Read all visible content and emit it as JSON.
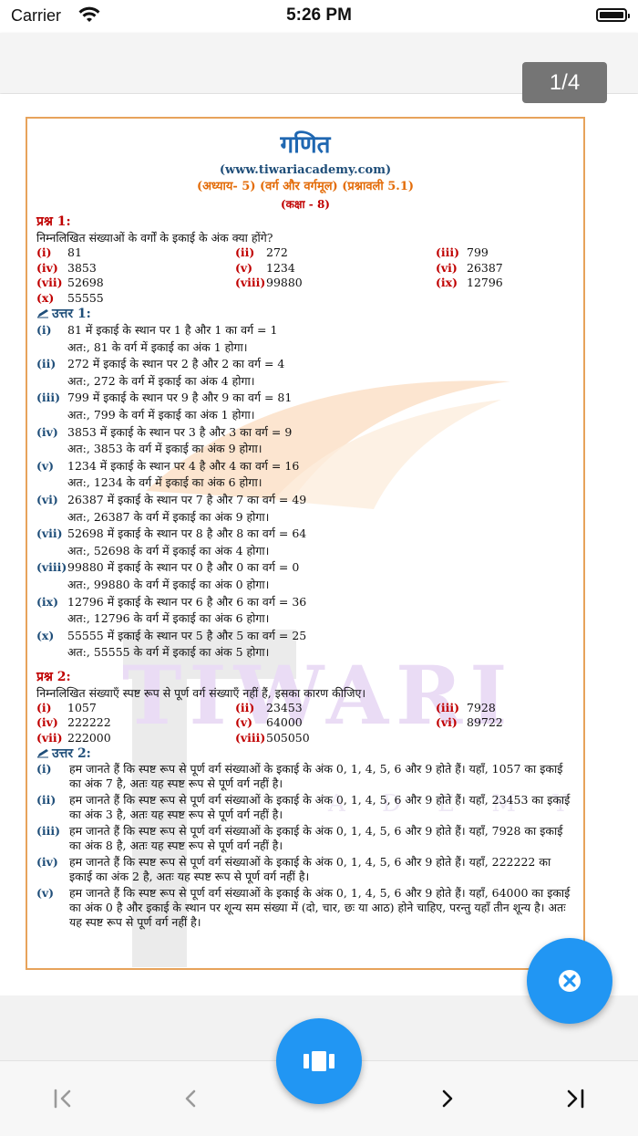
{
  "status_bar": {
    "carrier": "Carrier",
    "time": "5:26 PM"
  },
  "viewer": {
    "page_counter": "1/4"
  },
  "document": {
    "title": "गणित",
    "website": "(www.tiwariacademy.com)",
    "chapter": "(अध्याय- 5) (वर्ग और वर्गमूल) (प्रश्नावली 5.1)",
    "class_label": "(कक्षा - 8)",
    "watermark": {
      "brand": "TIWARI",
      "sub": "A D E M Y"
    },
    "q1": {
      "heading": "प्रश्न 1:",
      "text": "निम्नलिखित संख्याओं के वर्गों के इकाई के अंक क्या होंगे?",
      "options": [
        {
          "label": "(i)",
          "value": "81"
        },
        {
          "label": "(ii)",
          "value": "272"
        },
        {
          "label": "(iii)",
          "value": "799"
        },
        {
          "label": "(iv)",
          "value": "3853"
        },
        {
          "label": "(v)",
          "value": "1234"
        },
        {
          "label": "(vi)",
          "value": "26387"
        },
        {
          "label": "(vii)",
          "value": "52698"
        },
        {
          "label": "(viii)",
          "value": "99880"
        },
        {
          "label": "(ix)",
          "value": "12796"
        },
        {
          "label": "(x)",
          "value": "55555"
        }
      ]
    },
    "a1": {
      "heading": "उत्तर 1:",
      "items": [
        {
          "label": "(i)",
          "line1": "81 में इकाई के स्थान पर 1 है और 1 का वर्ग = 1",
          "line2": "अत:, 81 के वर्ग में इकाई का अंक 1 होगा।"
        },
        {
          "label": "(ii)",
          "line1": "272 में इकाई के स्थान पर 2 है और 2 का वर्ग = 4",
          "line2": "अत:, 272 के वर्ग में इकाई का अंक 4 होगा।"
        },
        {
          "label": "(iii)",
          "line1": "799 में इकाई के स्थान पर 9 है और 9 का वर्ग = 81",
          "line2": "अत:, 799 के वर्ग में इकाई का अंक 1 होगा।"
        },
        {
          "label": "(iv)",
          "line1": "3853 में इकाई के स्थान पर 3 है और 3 का वर्ग = 9",
          "line2": "अत:, 3853 के वर्ग में इकाई का अंक 9 होगा।"
        },
        {
          "label": "(v)",
          "line1": "1234 में इकाई के स्थान पर 4 है और 4 का वर्ग = 16",
          "line2": "अत:, 1234 के वर्ग में इकाई का अंक 6 होगा।"
        },
        {
          "label": "(vi)",
          "line1": "26387 में इकाई के स्थान पर 7 है और 7 का वर्ग = 49",
          "line2": "अत:, 26387 के वर्ग में इकाई का अंक 9 होगा।"
        },
        {
          "label": "(vii)",
          "line1": "52698 में इकाई के स्थान पर 8 है और 8 का वर्ग = 64",
          "line2": "अत:, 52698 के वर्ग में इकाई का अंक 4 होगा।"
        },
        {
          "label": "(viii)",
          "line1": "99880 में इकाई के स्थान पर 0 है और 0 का वर्ग = 0",
          "line2": "अत:, 99880 के वर्ग में इकाई का अंक 0 होगा।"
        },
        {
          "label": "(ix)",
          "line1": "12796 में इकाई के स्थान पर 6 है और 6 का वर्ग = 36",
          "line2": "अत:, 12796 के वर्ग में इकाई का अंक 6 होगा।"
        },
        {
          "label": "(x)",
          "line1": "55555 में इकाई के स्थान पर 5 है और 5 का वर्ग = 25",
          "line2": "अत:, 55555 के वर्ग में इकाई का अंक 5 होगा।"
        }
      ]
    },
    "q2": {
      "heading": "प्रश्न 2:",
      "text": "निम्नलिखित संख्याएँ स्पष्ट रूप से पूर्ण वर्ग संख्याएँ नहीं हैं, इसका कारण कीजिए।",
      "options": [
        {
          "label": "(i)",
          "value": "1057"
        },
        {
          "label": "(ii)",
          "value": "23453"
        },
        {
          "label": "(iii)",
          "value": "7928"
        },
        {
          "label": "(iv)",
          "value": "222222"
        },
        {
          "label": "(v)",
          "value": "64000"
        },
        {
          "label": "(vi)",
          "value": "89722"
        },
        {
          "label": "(vii)",
          "value": "222000"
        },
        {
          "label": "(viii)",
          "value": "505050"
        }
      ]
    },
    "a2": {
      "heading": "उत्तर 2:",
      "items": [
        {
          "label": "(i)",
          "text": "हम जानते हैं कि स्पष्ट रूप से पूर्ण वर्ग संख्याओं के इकाई के अंक 0, 1, 4, 5, 6 और 9 होते हैं। यहाँ, 1057 का इकाई का अंक 7 है, अतः यह स्पष्ट रूप से पूर्ण वर्ग नहीं है।"
        },
        {
          "label": "(ii)",
          "text": "हम जानते हैं कि स्पष्ट रूप से पूर्ण वर्ग संख्याओं के इकाई के अंक 0, 1, 4, 5, 6 और 9 होते हैं। यहाँ, 23453 का इकाई का अंक 3 है, अतः यह स्पष्ट रूप से पूर्ण वर्ग नहीं है।"
        },
        {
          "label": "(iii)",
          "text": "हम जानते हैं कि स्पष्ट रूप से पूर्ण वर्ग संख्याओं के इकाई के अंक 0, 1, 4, 5, 6 और 9 होते हैं। यहाँ, 7928 का इकाई का अंक 8 है, अतः यह स्पष्ट रूप से पूर्ण वर्ग नहीं है।"
        },
        {
          "label": "(iv)",
          "text": "हम जानते हैं कि स्पष्ट रूप से पूर्ण वर्ग संख्याओं के इकाई के अंक 0, 1, 4, 5, 6 और 9 होते हैं। यहाँ, 222222 का इकाई का अंक 2 है, अतः यह स्पष्ट रूप से पूर्ण वर्ग नहीं है।"
        },
        {
          "label": "(v)",
          "text": "हम जानते हैं कि स्पष्ट रूप से पूर्ण वर्ग संख्याओं के इकाई के अंक 0, 1, 4, 5, 6 और 9 होते हैं। यहाँ, 64000 का इकाई का अंक 0 है और इकाई के स्थान पर शून्य सम संख्या में (दो, चार, छः या आठ) होने चाहिए, परन्तु यहाँ तीन शून्य है। अतः यह स्पष्ट रूप से पूर्ण वर्ग नहीं है।"
        }
      ]
    }
  },
  "colors": {
    "accent": "#2196f3",
    "border": "#e7a35b",
    "question": "#c00000",
    "answer": "#1f4e79",
    "title": "#1f67b1"
  }
}
